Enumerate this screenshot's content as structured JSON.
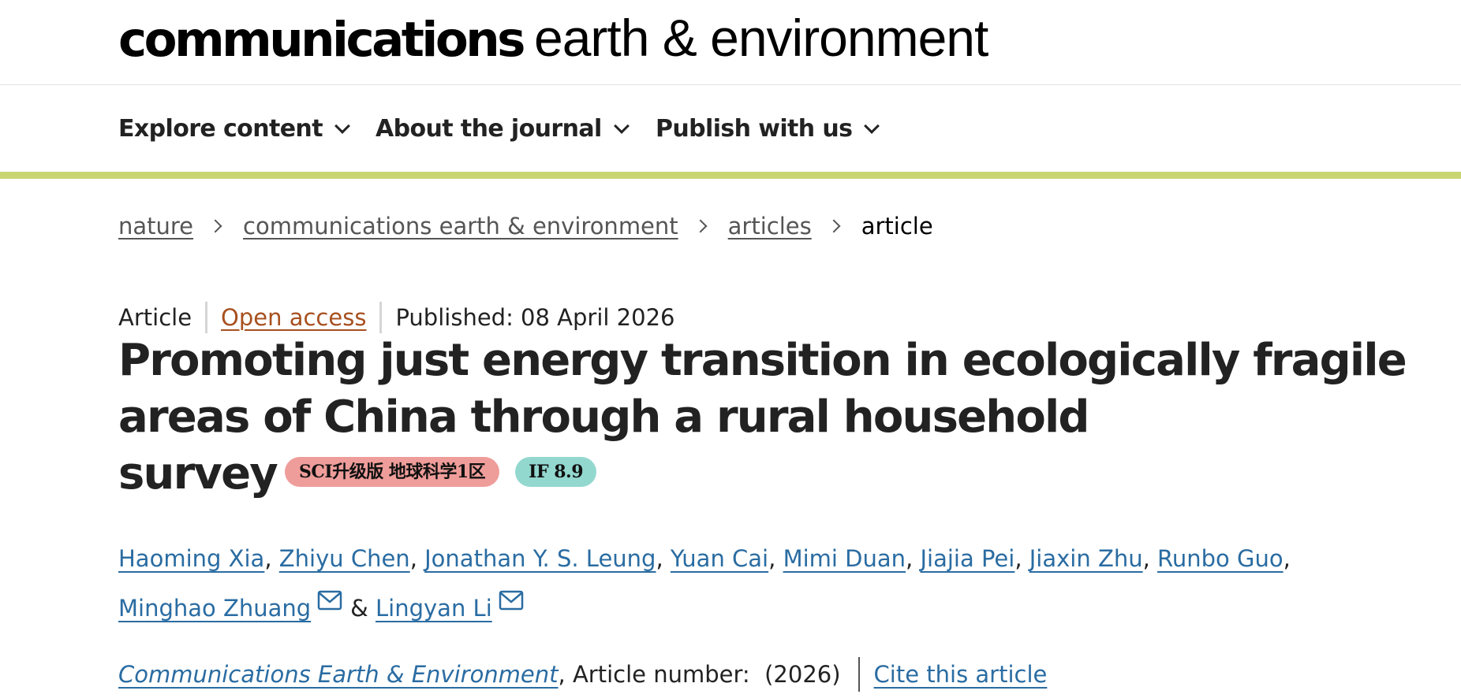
{
  "header": {
    "logo_bold": "communications",
    "logo_light": "earth & environment"
  },
  "nav": {
    "items": [
      {
        "label": "Explore content"
      },
      {
        "label": "About the journal"
      },
      {
        "label": "Publish with us"
      }
    ]
  },
  "breadcrumb": {
    "items": [
      "nature",
      "communications earth & environment",
      "articles"
    ],
    "current": "article"
  },
  "meta": {
    "type": "Article",
    "access": "Open access",
    "published": "Published: 08 April 2026"
  },
  "title": {
    "line1": "Promoting just energy transition in ecologically fragile",
    "line2": "areas of China through a rural household",
    "line3": "survey"
  },
  "badges": {
    "sci": "SCI升级版 地球科学1区",
    "if": "IF 8.9",
    "sci_color": "#ef9d9a",
    "if_color": "#93d8cf"
  },
  "authors": [
    "Haoming Xia",
    "Zhiyu Chen",
    "Jonathan Y. S. Leung",
    "Yuan Cai",
    "Mimi Duan",
    "Jiajia Pei",
    "Jiaxin Zhu",
    "Runbo Guo",
    "Minghao Zhuang",
    "Lingyan Li"
  ],
  "authors_separator": ",",
  "authors_and": "&",
  "citation": {
    "journal": "Communications Earth & Environment",
    "article_number": ", Article number:  (2026)",
    "cite_label": "Cite this article"
  },
  "colors": {
    "accent_bar": "#c8d672",
    "link": "#2a6ca2",
    "open_access": "#a7501f"
  },
  "icons": {
    "nav_chevron": "chevron-down-icon",
    "breadcrumb_separator": "chevron-right-icon",
    "corresponding_author": "mail-icon"
  }
}
